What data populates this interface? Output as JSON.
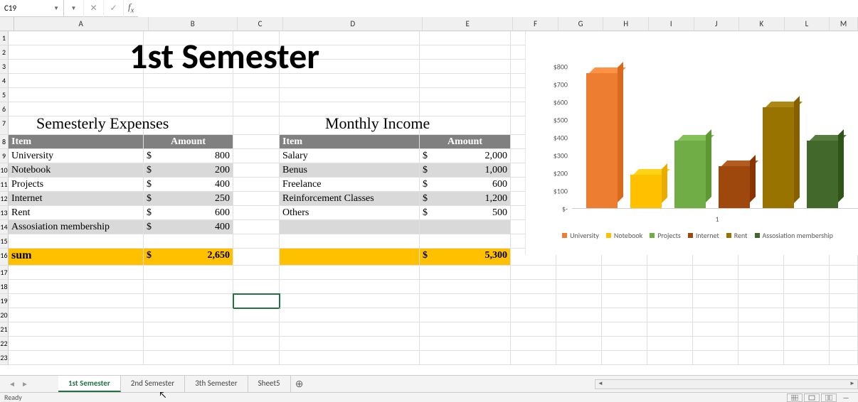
{
  "name_box": "C19",
  "formula": "",
  "title": "1st Semester",
  "expenses": {
    "title": "Semesterly Expenses",
    "header_item": "Item",
    "header_amount": "Amount",
    "rows": [
      {
        "item": "University",
        "sym": "$",
        "amount": "800"
      },
      {
        "item": "Notebook",
        "sym": "$",
        "amount": "200"
      },
      {
        "item": "Projects",
        "sym": "$",
        "amount": "400"
      },
      {
        "item": "Internet",
        "sym": "$",
        "amount": "250"
      },
      {
        "item": "Rent",
        "sym": "$",
        "amount": "600"
      },
      {
        "item": "Assosiation membership",
        "sym": "$",
        "amount": "400"
      }
    ],
    "sum_label": "sum",
    "sum_sym": "$",
    "sum_amount": "2,650"
  },
  "income": {
    "title": "Monthly Income",
    "header_item": "Item",
    "header_amount": "Amount",
    "rows": [
      {
        "item": "Salary",
        "sym": "$",
        "amount": "2,000"
      },
      {
        "item": "Benus",
        "sym": "$",
        "amount": "1,000"
      },
      {
        "item": "Freelance",
        "sym": "$",
        "amount": "600"
      },
      {
        "item": "Reinforcement Classes",
        "sym": "$",
        "amount": "1,200"
      },
      {
        "item": "Others",
        "sym": "$",
        "amount": "500"
      }
    ],
    "sum_sym": "$",
    "sum_amount": "5,300"
  },
  "chart_data": {
    "type": "bar",
    "categories": [
      "University",
      "Notebook",
      "Projects",
      "Internet",
      "Rent",
      "Assosiation membership"
    ],
    "values": [
      800,
      200,
      400,
      250,
      600,
      400
    ],
    "xlabel": "1",
    "ylabel": "",
    "ylim": [
      0,
      800
    ],
    "y_ticks": [
      "$800",
      "$700",
      "$600",
      "$500",
      "$400",
      "$300",
      "$200",
      "$100",
      "$-"
    ],
    "colors": [
      "#ed7d31",
      "#ffc000",
      "#70ad47",
      "#9e480e",
      "#997300",
      "#43682b"
    ]
  },
  "columns": [
    "A",
    "B",
    "C",
    "D",
    "E",
    "F",
    "G",
    "H",
    "I",
    "J",
    "K",
    "L",
    "M"
  ],
  "row_numbers": [
    1,
    2,
    3,
    4,
    5,
    6,
    7,
    8,
    9,
    10,
    11,
    12,
    13,
    14,
    15,
    16,
    17,
    18,
    19,
    20,
    21,
    22,
    23
  ],
  "tabs": [
    "1st Semester",
    "2nd Semester",
    "3th Semester",
    "Sheet5"
  ],
  "active_tab": 0,
  "status": "Ready"
}
